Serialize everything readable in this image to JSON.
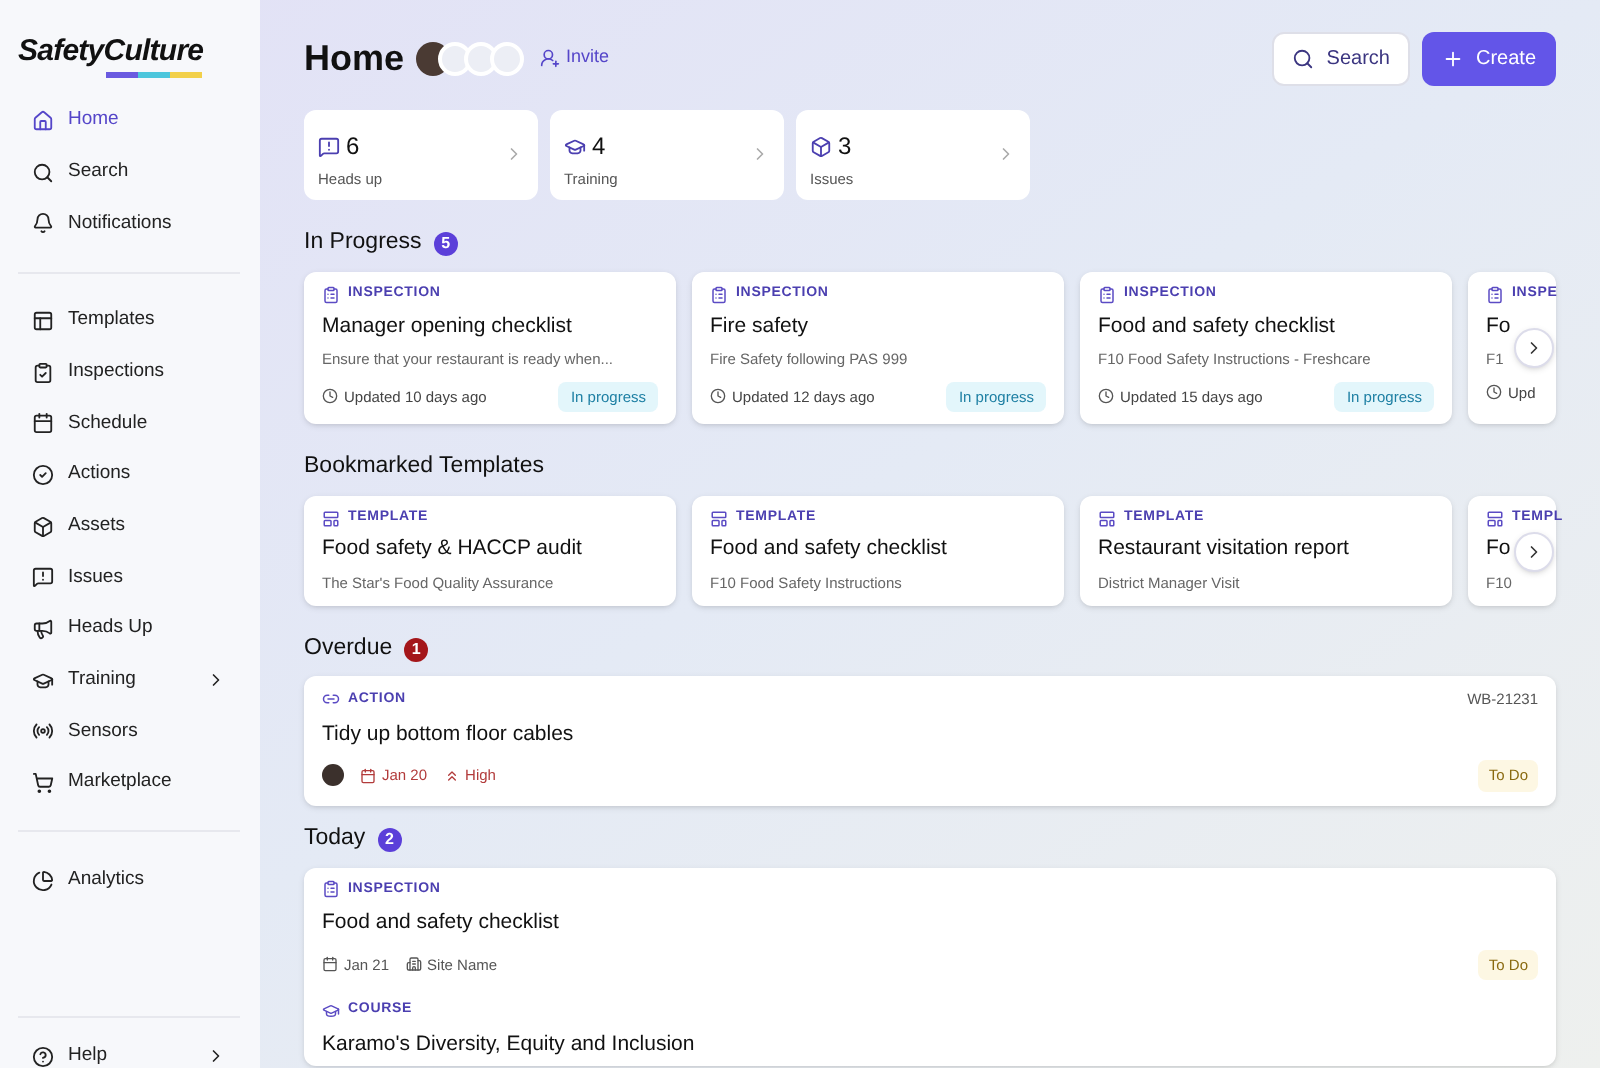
{
  "sidebar": {
    "logo": "SafetyCulture",
    "groups": [
      [
        {
          "label": "Home",
          "selected": true
        },
        {
          "label": "Search",
          "selected": false
        },
        {
          "label": "Notifications",
          "selected": false
        }
      ],
      [
        {
          "label": "Templates",
          "selected": false
        },
        {
          "label": "Inspections",
          "selected": false
        },
        {
          "label": "Schedule",
          "selected": false
        },
        {
          "label": "Actions",
          "selected": false
        },
        {
          "label": "Assets",
          "selected": false
        },
        {
          "label": "Issues",
          "selected": false
        },
        {
          "label": "Heads Up",
          "selected": false
        },
        {
          "label": "Training",
          "selected": false,
          "expandable": true
        },
        {
          "label": "Sensors",
          "selected": false
        },
        {
          "label": "Marketplace",
          "selected": false
        }
      ],
      [
        {
          "label": "Analytics",
          "selected": false
        }
      ]
    ],
    "footer": {
      "label": "Help"
    }
  },
  "header": {
    "title": "Home",
    "invite": "Invite",
    "search": "Search",
    "create": "Create"
  },
  "stats": [
    {
      "value": "6",
      "label": "Heads up"
    },
    {
      "value": "4",
      "label": "Training"
    },
    {
      "value": "3",
      "label": "Issues"
    }
  ],
  "in_progress": {
    "title": "In Progress",
    "count": "5",
    "color": "#5b3fd9",
    "cards": [
      {
        "kind": "inspection",
        "tag": "INSPECTION",
        "title": "Manager opening checklist",
        "subtitle": "Ensure that your restaurant is ready when...",
        "updated": "Updated 10 days ago",
        "status": "In progress"
      },
      {
        "kind": "inspection",
        "tag": "INSPECTION",
        "title": "Fire safety",
        "subtitle": "Fire Safety following PAS 999",
        "updated": "Updated 12 days ago",
        "status": "In progress"
      },
      {
        "kind": "inspection",
        "tag": "INSPECTION",
        "title": "Food and safety checklist",
        "subtitle": "F10 Food Safety Instructions - Freshcare",
        "updated": "Updated 15 days ago",
        "status": "In progress"
      },
      {
        "kind": "inspection",
        "tag": "INSPE",
        "title": "Fo",
        "subtitle": "F1",
        "updated": "Upd"
      }
    ]
  },
  "bookmarked": {
    "title": "Bookmarked Templates",
    "cards": [
      {
        "kind": "template",
        "tag": "TEMPLATE",
        "title": "Food safety & HACCP audit",
        "subtitle": "The Star's Food Quality Assurance"
      },
      {
        "kind": "template",
        "tag": "TEMPLATE",
        "title": "Food and safety checklist",
        "subtitle": "F10 Food Safety Instructions"
      },
      {
        "kind": "template",
        "tag": "TEMPLATE",
        "title": "Restaurant visitation report",
        "subtitle": "District Manager Visit"
      },
      {
        "kind": "template",
        "tag": "TEMPL",
        "title": "Fo",
        "subtitle": "F10"
      }
    ]
  },
  "overdue": {
    "title": "Overdue",
    "count": "1",
    "color": "#a4161a",
    "items": [
      {
        "kind": "action",
        "tag": "ACTION",
        "title": "Tidy up bottom floor cables",
        "reference": "WB-21231",
        "meta": [
          {
            "kind": "assignee"
          },
          {
            "kind": "date",
            "text": "Jan 20"
          },
          {
            "kind": "priority",
            "text": "High"
          }
        ],
        "status": "To Do",
        "late": true
      }
    ]
  },
  "today": {
    "title": "Today",
    "count": "2",
    "color": "#5b3fd9",
    "items": [
      {
        "kind": "inspection",
        "tag": "INSPECTION",
        "title": "Food and safety checklist",
        "meta": [
          {
            "kind": "date",
            "text": "Jan 21"
          },
          {
            "kind": "site",
            "text": "Site Name"
          }
        ],
        "status": "To Do",
        "late": false
      },
      {
        "kind": "course",
        "tag": "COURSE",
        "title": "Karamo's Diversity, Equity and Inclusion"
      }
    ]
  }
}
